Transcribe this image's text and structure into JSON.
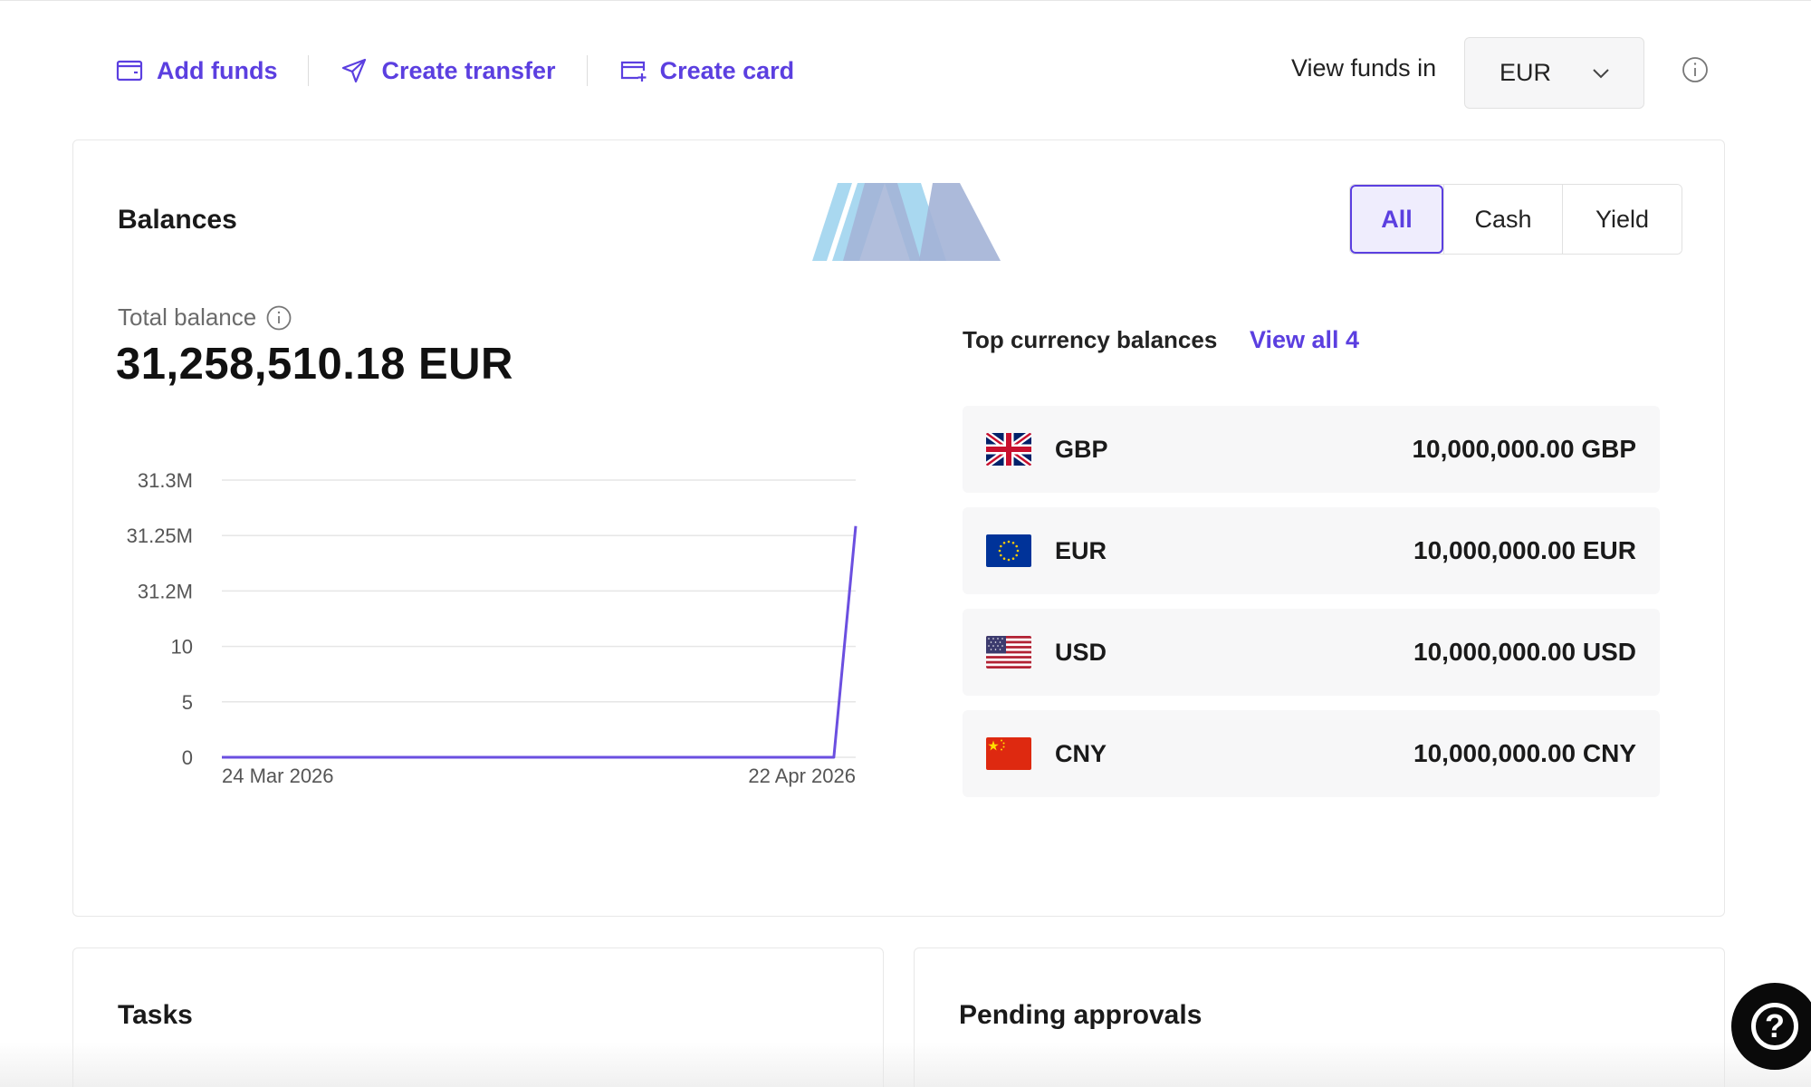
{
  "toolbar": {
    "add_funds": "Add funds",
    "create_transfer": "Create transfer",
    "create_card": "Create card",
    "view_funds_label": "View funds in",
    "view_funds_value": "EUR"
  },
  "balances": {
    "title": "Balances",
    "filters": [
      {
        "label": "All",
        "active": true
      },
      {
        "label": "Cash",
        "active": false
      },
      {
        "label": "Yield",
        "active": false
      }
    ],
    "total_label": "Total balance",
    "total_value": "31,258,510.18 EUR",
    "top_currency_title": "Top currency balances",
    "view_all": "View all 4",
    "currencies": [
      {
        "code": "GBP",
        "amount": "10,000,000.00 GBP",
        "flag": "uk-flag-icon"
      },
      {
        "code": "EUR",
        "amount": "10,000,000.00 EUR",
        "flag": "eu-flag-icon"
      },
      {
        "code": "USD",
        "amount": "10,000,000.00 USD",
        "flag": "us-flag-icon"
      },
      {
        "code": "CNY",
        "amount": "10,000,000.00 CNY",
        "flag": "china-flag-icon"
      }
    ]
  },
  "chart_data": {
    "type": "line",
    "x_labels": [
      "24 Mar 2026",
      "22 Apr 2026"
    ],
    "y_tick_labels": [
      "0",
      "5",
      "10",
      "31.2M",
      "31.25M",
      "31.3M"
    ],
    "series": [
      {
        "values": [
          {
            "x": "24 Mar 2026",
            "y": 0
          },
          {
            "x": "21 Apr 2026",
            "y": 0
          },
          {
            "x": "22 Apr 2026",
            "y": 31258510.18
          }
        ]
      }
    ],
    "line_color": "#6b4fe0",
    "grid": true
  },
  "tasks": {
    "title": "Tasks"
  },
  "pending": {
    "title": "Pending approvals"
  },
  "colors": {
    "accent": "#5b3fe0"
  }
}
